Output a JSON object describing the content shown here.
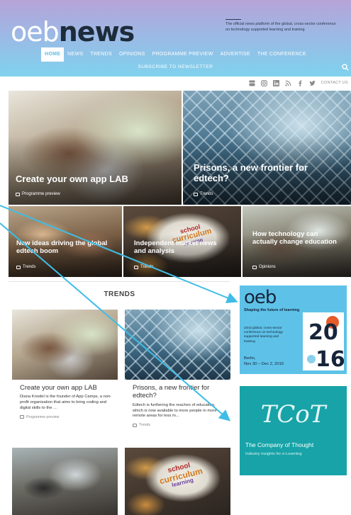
{
  "header": {
    "logo_part1": "oeb",
    "logo_part2": "news",
    "tagline": "The official news platform of the global, cross-sector conference on technology supported learning and training"
  },
  "nav": {
    "items": [
      "HOME",
      "NEWS",
      "TRENDS",
      "OPINIONS",
      "PROGRAMME PREVIEW",
      "ADVERTISE",
      "THE CONFERENCE"
    ],
    "active": "HOME",
    "subscribe": "SUBSCRIBE TO NEWSLETTER"
  },
  "social": {
    "icons": [
      "youtube-icon",
      "instagram-icon",
      "linkedin-icon",
      "rss-icon",
      "facebook-icon",
      "twitter-icon"
    ],
    "contact": "CONTACT US"
  },
  "hero": [
    {
      "title": "Create your own app LAB",
      "category": "Programme preview"
    },
    {
      "title": "Prisons, a new frontier for edtech?",
      "category": "Trends"
    },
    {
      "title": "New ideas driving the global edtech boom",
      "category": "Trends"
    },
    {
      "title": "Independent market news and analysis",
      "category": "Trends"
    },
    {
      "title": "How technology can actually change education",
      "category": "Opinions"
    }
  ],
  "trends": {
    "heading": "TRENDS",
    "cards": [
      {
        "title": "Create your own app LAB",
        "text": "Diana Knodel is the founder of App Camps, a non-profit organisation that aims to bring coding and digital skills to the ...",
        "category": "Programme preview"
      },
      {
        "title": "Prisons, a new frontier for edtech?",
        "text": "Edtech is furthering the reaches of education, which is now available to more people in more remote areas for less m...",
        "category": "Trends"
      }
    ]
  },
  "ads": {
    "oeb": {
      "brand": "oeb",
      "tagline": "Shaping the future of learning",
      "sub": "22nd global, cross-sector conference on technology supported learning and training",
      "where": "Berlin,",
      "dates": "Nov 30 – Dec 2, 2016",
      "year_top": "20",
      "year_bottom": "16"
    },
    "cot": {
      "monogram": "TCoT",
      "name": "The Company of Thought",
      "tagline": "Industry insights for e-Learning"
    }
  },
  "wordcloud": {
    "words": [
      "school",
      "curriculum",
      "learning"
    ]
  },
  "colors": {
    "header_top": "#b7a3d8",
    "header_bottom": "#7fd2ee",
    "nav_active_text": "#5bbde6",
    "arrow": "#3fbde6",
    "oeb_ad": "#5ec2e8",
    "cot_ad": "#17a3a8"
  }
}
